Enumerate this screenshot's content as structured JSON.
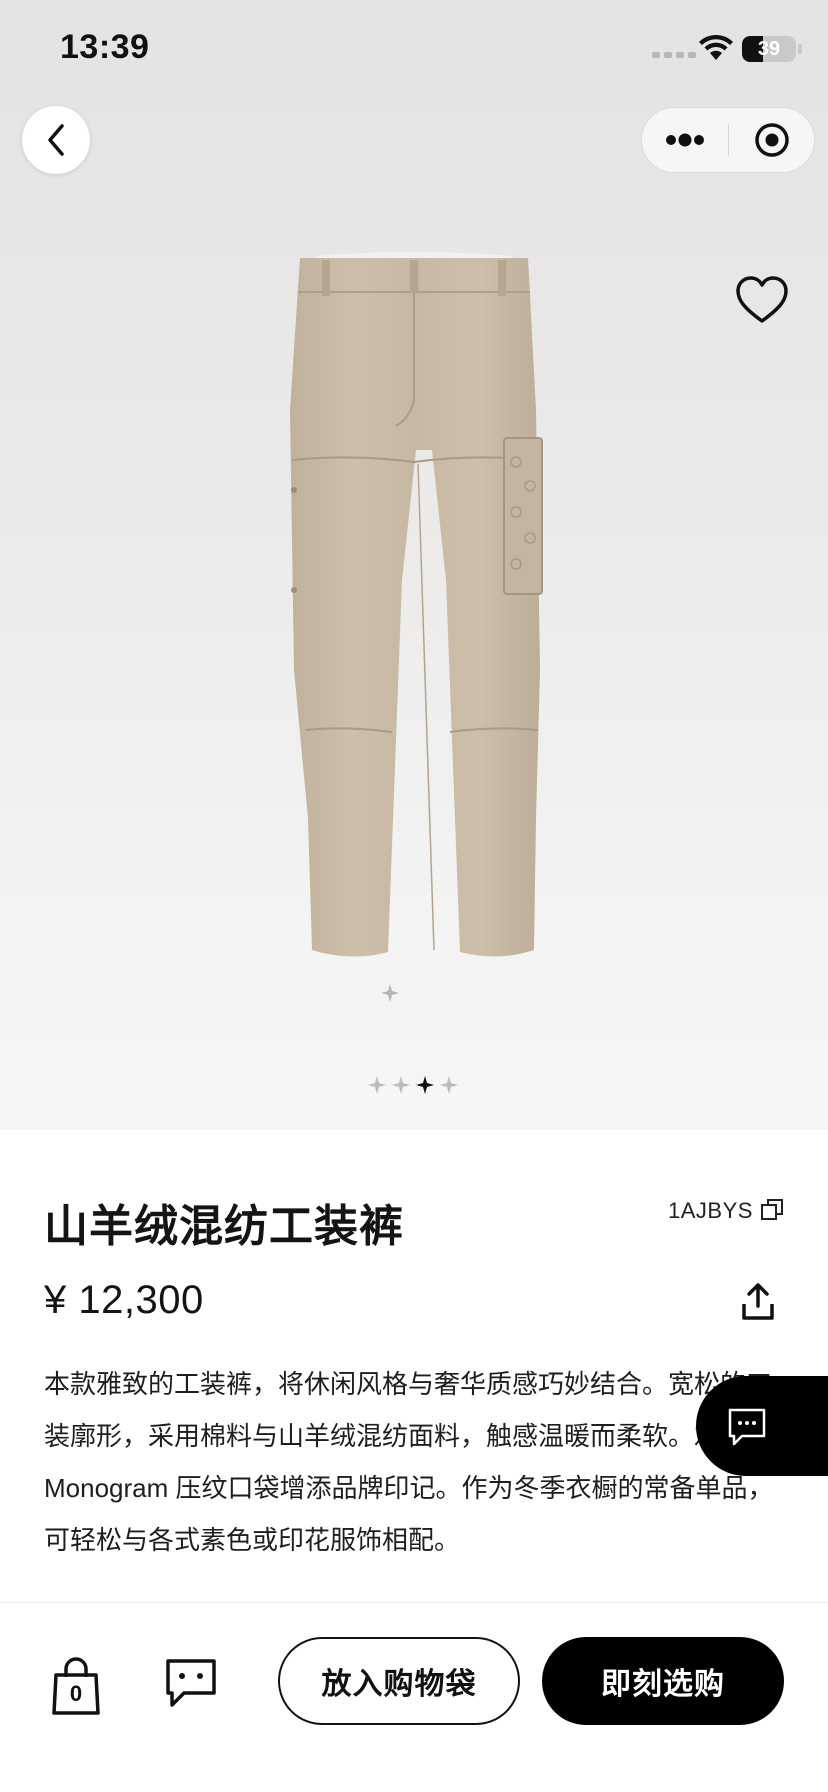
{
  "status_bar": {
    "time": "13:39",
    "battery_level": "39"
  },
  "nav": {
    "back_icon": "chevron-left-icon",
    "more_icon": "more-dots-icon",
    "close_icon": "target-circle-icon"
  },
  "product": {
    "wishlist_icon": "heart-outline-icon",
    "title": "山羊绒混纺工装裤",
    "sku": "1AJBYS",
    "copy_icon": "copy-icon",
    "price": "¥ 12,300",
    "share_icon": "share-icon",
    "description": "本款雅致的工装裤，将休闲风格与奢华质感巧妙结合。宽松的工装廓形，采用棉料与山羊绒混纺面料，触感温暖而柔软。左腿的 Monogram 压纹口袋增添品牌印记。作为冬季衣橱的常备单品，可轻松与各式素色或印花服饰相配。",
    "carousel": {
      "total": 4,
      "active_index": 2
    }
  },
  "chat": {
    "icon": "chat-bubble-icon"
  },
  "bottom_bar": {
    "bag_count": "0",
    "bag_icon": "shopping-bag-icon",
    "contact_icon": "chat-bubble-icon",
    "add_to_bag_label": "放入购物袋",
    "buy_now_label": "即刻选购"
  },
  "colors": {
    "primary": "#000000",
    "background": "#ffffff",
    "hero_background": "#e8e7e6",
    "product_beige": "#c9bba6"
  }
}
